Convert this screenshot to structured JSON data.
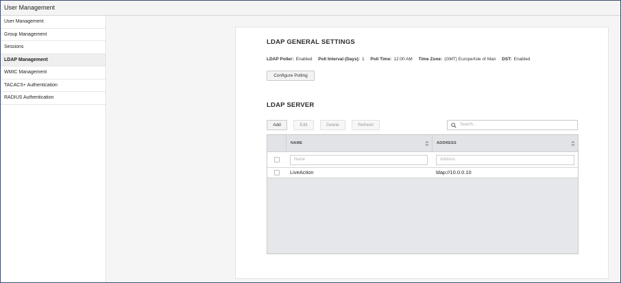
{
  "window": {
    "title": "User Management"
  },
  "sidebar": {
    "items": [
      {
        "label": "User Management"
      },
      {
        "label": "Group Management"
      },
      {
        "label": "Sessions"
      },
      {
        "label": "LDAP Management"
      },
      {
        "label": "WMIC Management"
      },
      {
        "label": "TACACS+ Authentication"
      },
      {
        "label": "RADIUS Authentication"
      }
    ],
    "active": "LDAP Management"
  },
  "general": {
    "title": "LDAP GENERAL SETTINGS",
    "poller_label": "LDAP Poller:",
    "poller_value": "Enabled",
    "interval_label": "Poll Interval (Days):",
    "interval_value": "1",
    "time_label": "Poll Time:",
    "time_value": "12:00 AM",
    "zone_label": "Time Zone:",
    "zone_value": "(GMT) Europe/Isle of Man",
    "dst_label": "DST:",
    "dst_value": "Enabled",
    "configure_label": "Configure Polling"
  },
  "server": {
    "title": "LDAP SERVER",
    "add_label": "Add",
    "edit_label": "Edit",
    "delete_label": "Delete",
    "refresh_label": "Refresh",
    "search_placeholder": "Search...",
    "columns": {
      "name": "NAME",
      "address": "ADDRESS"
    },
    "filter_name_placeholder": "Name",
    "filter_address_placeholder": "Address",
    "rows": [
      {
        "name": "LiveAction",
        "address": "ldap://10.0.0.10"
      }
    ]
  },
  "icons": {
    "search": "search-icon",
    "sort": "sort-icon"
  }
}
